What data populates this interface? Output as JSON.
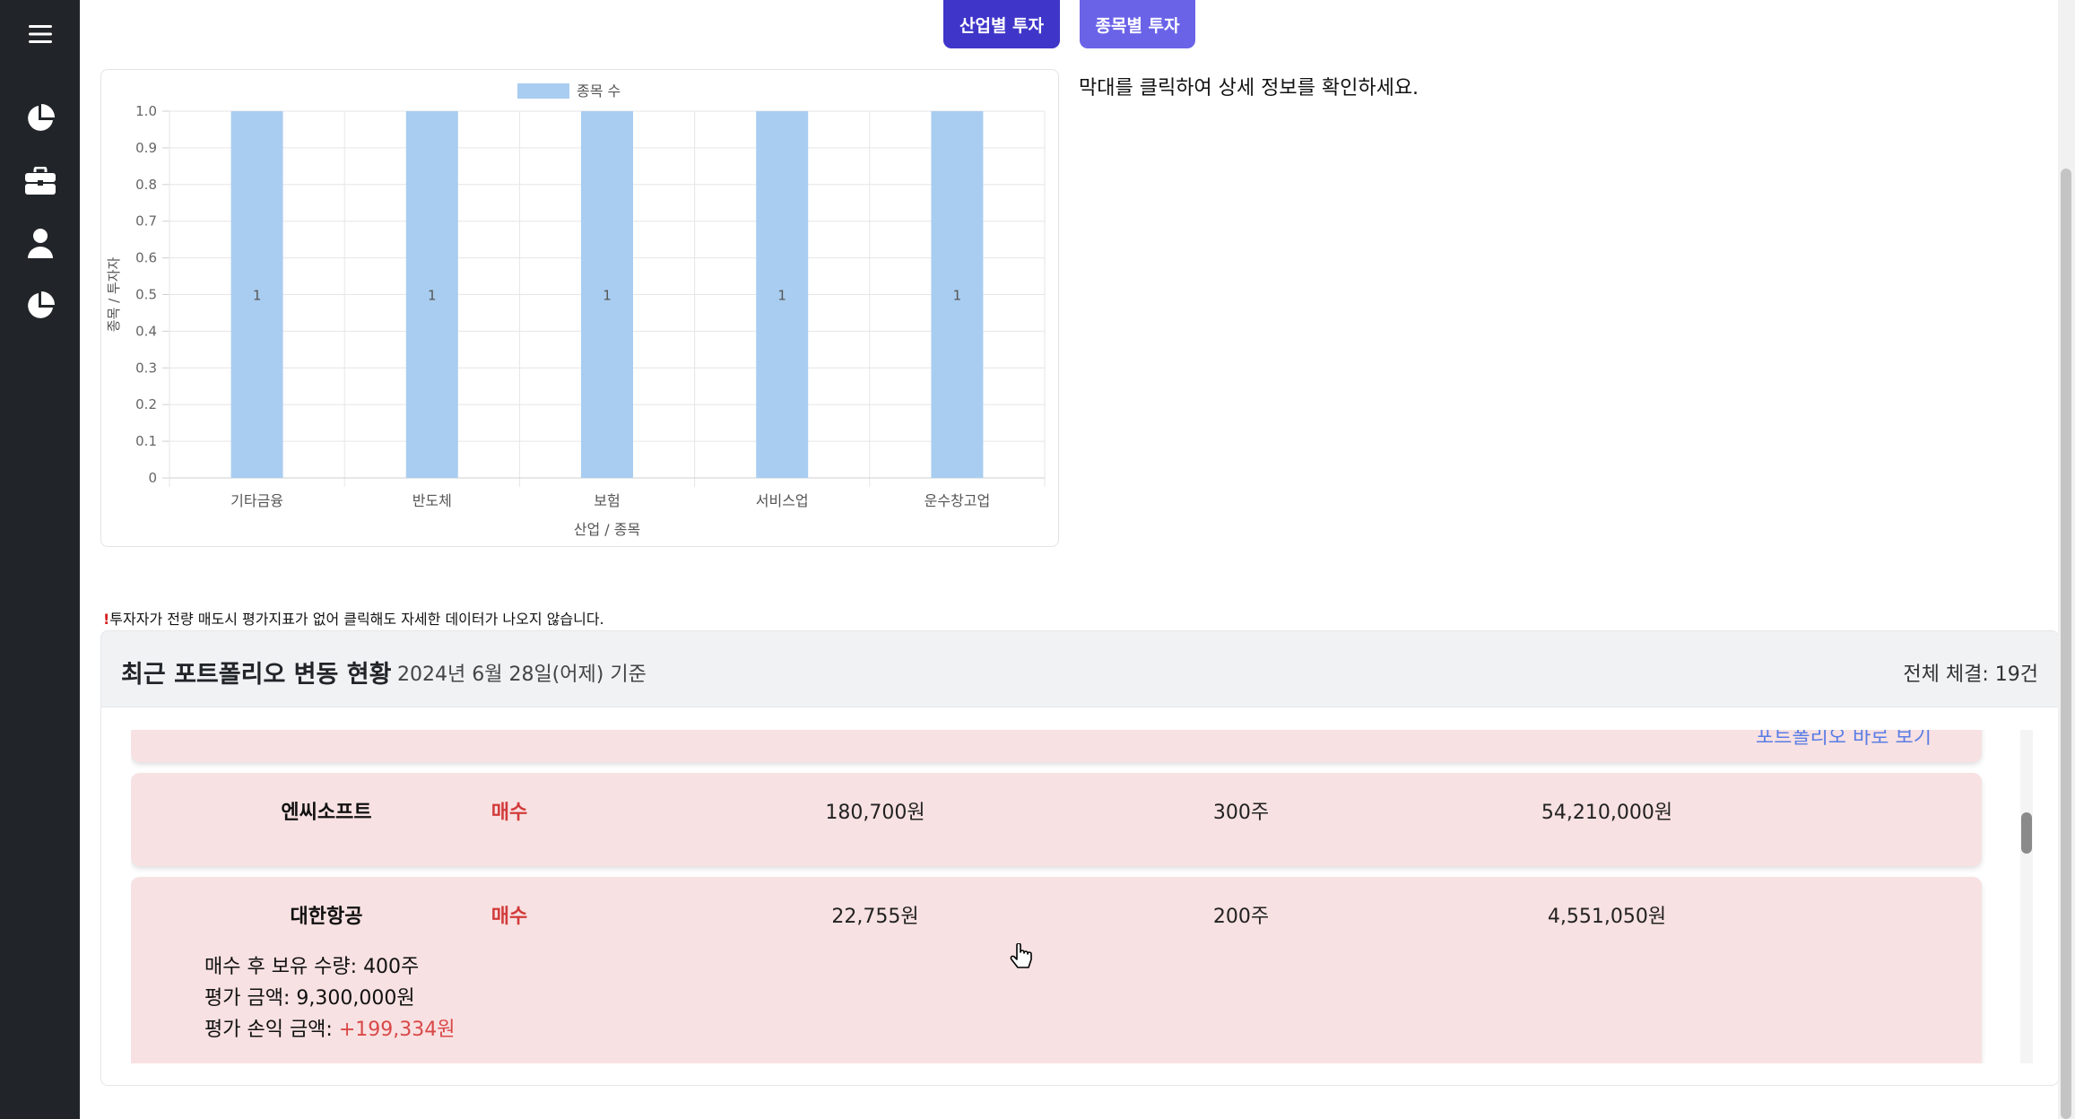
{
  "sidebar": {
    "items": [
      {
        "icon": "menu-icon"
      },
      {
        "icon": "pie-chart-icon"
      },
      {
        "icon": "briefcase-icon"
      },
      {
        "icon": "user-icon"
      },
      {
        "icon": "pie-chart-icon"
      }
    ]
  },
  "view_toggle": {
    "industry_label": "산업별 투자",
    "stock_label": "종목별 투자"
  },
  "hint_text": "막대를 클릭하여 상세 정보를 확인하세요.",
  "chart_data": {
    "type": "bar",
    "categories": [
      "기타금융",
      "반도체",
      "보험",
      "서비스업",
      "운수창고업"
    ],
    "series": [
      {
        "name": "종목 수",
        "values": [
          1,
          1,
          1,
          1,
          1
        ],
        "color": "#a9cdf0"
      }
    ],
    "data_labels": [
      "1",
      "1",
      "1",
      "1",
      "1"
    ],
    "xlabel": "산업 / 종목",
    "ylabel": "종목 / 투자자",
    "ylim": [
      0,
      1.0
    ],
    "yticks": [
      "0",
      "0.1",
      "0.2",
      "0.3",
      "0.4",
      "0.5",
      "0.6",
      "0.7",
      "0.8",
      "0.9",
      "1.0"
    ],
    "grid": true,
    "legend_position": "top"
  },
  "warning": {
    "mark": "!",
    "text": "투자자가 전량 매도시 평가지표가 없어 클릭해도 자세한 데이터가 나오지 않습니다."
  },
  "recent": {
    "title": "최근 포트폴리오 변동 현황",
    "date": "2024년 6월 28일(어제) 기준",
    "total": "전체 체결: 19건",
    "prev_link": "포트폴리오 바로 보기",
    "trades": [
      {
        "name": "엔씨소프트",
        "type": "매수",
        "price": "180,700원",
        "quantity": "300주",
        "amount": "54,210,000원"
      },
      {
        "name": "대한항공",
        "type": "매수",
        "price": "22,755원",
        "quantity": "200주",
        "amount": "4,551,050원",
        "holding_label": "매수 후 보유 수량: 400주",
        "eval_label": "평가 금액: 9,300,000원",
        "pnl_label": "평가 손익 금액: ",
        "pnl_value": "+199,334원"
      }
    ]
  },
  "colors": {
    "sidebar_bg": "#212529",
    "industry_btn": "#3f35c9",
    "stock_btn": "#6a63e8",
    "buy_color": "#d23b3b",
    "card_bg": "#f8e1e2"
  }
}
